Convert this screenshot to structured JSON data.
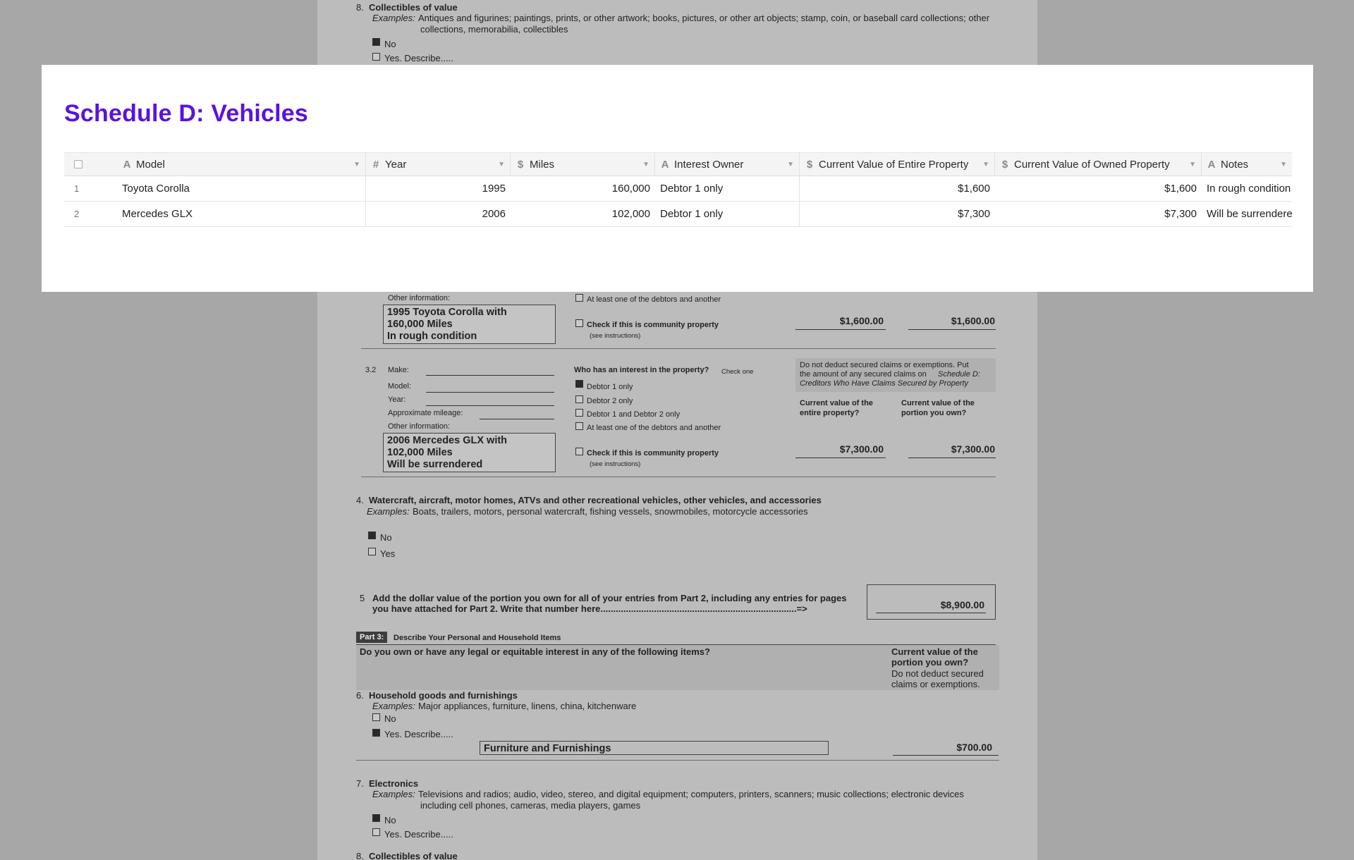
{
  "panel": {
    "title": "Schedule D: Vehicles",
    "columns": [
      {
        "label": "Model",
        "icon": "A"
      },
      {
        "label": "Year",
        "icon": "#"
      },
      {
        "label": "Miles",
        "icon": "$"
      },
      {
        "label": "Interest Owner",
        "icon": "A"
      },
      {
        "label": "Current Value of Entire Property",
        "icon": "$"
      },
      {
        "label": "Current Value of Owned Property",
        "icon": "$"
      },
      {
        "label": "Notes",
        "icon": "A"
      }
    ],
    "rows": [
      {
        "num": "1",
        "model": "Toyota Corolla",
        "year": "1995",
        "miles": "160,000",
        "owner": "Debtor 1 only",
        "entire": "$1,600",
        "owned": "$1,600",
        "notes": "In rough condition"
      },
      {
        "num": "2",
        "model": "Mercedes GLX",
        "year": "2006",
        "miles": "102,000",
        "owner": "Debtor 1 only",
        "entire": "$7,300",
        "owned": "$7,300",
        "notes": "Will be surrendered"
      }
    ]
  },
  "doc": {
    "top": {
      "num": "8.",
      "title": "Collectibles of value",
      "ex_label": "Examples:",
      "ex_line1": "Antiques and figurines; paintings, prints, or other artwork; books, pictures, or other art objects; stamp, coin, or baseball card collections; other",
      "ex_line2": "collections, memorabilia, collectibles",
      "no": "No",
      "yes": "Yes.  Describe....."
    },
    "v1": {
      "other_info": "Other information:",
      "box": [
        "1995 Toyota Corolla with",
        "160,000 Miles",
        "In rough condition"
      ],
      "atleast": "At least one of the debtors and another",
      "community": "Check if this is community property",
      "see": "(see instructions)",
      "val_entire": "$1,600.00",
      "val_owned": "$1,600.00"
    },
    "v2": {
      "num": "3.2",
      "make": "Make:",
      "model": "Model:",
      "year": "Year:",
      "mileage": "Approximate mileage:",
      "other_info": "Other information:",
      "who": "Who has an interest in the property?",
      "check_one": "Check one",
      "d1": "Debtor 1 only",
      "d2": "Debtor 2 only",
      "d12": "Debtor 1 and Debtor 2 only",
      "atleast": "At least one of the debtors and another",
      "note1": "Do not deduct secured claims or exemptions. Put",
      "note2": "the amount of any secured claims on",
      "note2i": "Schedule D:",
      "note3i": "Creditors Who Have Claims Secured by Property",
      "cv_entire1": "Current value of the",
      "cv_entire2": "entire property?",
      "cv_owned1": "Current value of the",
      "cv_owned2": "portion you own?",
      "box": [
        "2006 Mercedes GLX with",
        "102,000 Miles",
        "Will be surrendered"
      ],
      "community": "Check if this is community property",
      "see": "(see instructions)",
      "val_entire": "$7,300.00",
      "val_owned": "$7,300.00"
    },
    "q4": {
      "num": "4.",
      "title": "Watercraft, aircraft, motor homes, ATVs and other recreational vehicles, other vehicles, and accessories",
      "ex_label": "Examples:",
      "ex": "Boats, trailers, motors, personal watercraft, fishing vessels, snowmobiles, motorcycle accessories",
      "no": "No",
      "yes": "Yes"
    },
    "q5": {
      "num": "5",
      "line1": "Add the dollar value of the portion you own for all of your entries from Part 2, including any entries for pages",
      "line2": "you have attached for Part 2. Write that number here.............................................................................=>",
      "total": "$8,900.00"
    },
    "part3": {
      "tag": "Part 3:",
      "title": "Describe Your Personal and  Household Items",
      "question": "Do you own or have any legal or equitable interest in any of the following items?",
      "cv1": "Current value of the",
      "cv2": "portion you own?",
      "cv3": "Do not deduct secured",
      "cv4": "claims or exemptions."
    },
    "q6": {
      "num": "6.",
      "title": "Household goods and furnishings",
      "ex_label": "Examples:",
      "ex": "Major appliances, furniture, linens, china, kitchenware",
      "no": "No",
      "yes": "Yes.  Describe.....",
      "desc": "Furniture and Furnishings",
      "value": "$700.00"
    },
    "q7": {
      "num": "7.",
      "title": "Electronics",
      "ex_label": "Examples:",
      "ex_line1": "Televisions and radios; audio, video, stereo, and digital equipment; computers, printers, scanners; music collections; electronic devices",
      "ex_line2": "including cell phones, cameras, media players, games",
      "no": "No",
      "yes": "Yes.  Describe....."
    },
    "bottom": {
      "num": "8.",
      "title": "Collectibles of value"
    }
  }
}
